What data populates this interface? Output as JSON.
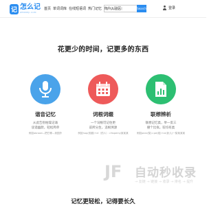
{
  "header": {
    "logo_glyph": "记",
    "logo_text": "怎么记",
    "logo_sub": "ZENMEJI.COM",
    "nav": [
      "首页",
      "单词词库",
      "在线短语词",
      "热门记忆",
      "商户入驻区"
    ],
    "search_placeholder": "查询英语单词",
    "search_button": "Search",
    "login_label": "登录"
  },
  "hero": {
    "title": "花更少的时间，记更多的东西"
  },
  "features": [
    {
      "icon": "microphone-icon",
      "color": "#4aa3ea",
      "title": "谐音记忆",
      "lines": [
        "从此告别枯燥记诵",
        "谈谐幽默，轻松简单"
      ],
      "note": "例如abroad—把它哪—到国外"
    },
    {
      "icon": "calendar-icon",
      "color": "#ee5a5a",
      "title": "词根词缀",
      "lines": [
        "一个词根可记住更",
        "前所分生，追根溯源"
      ],
      "note": "例如hop(双腿)+el（的人）=Hopemy某某某"
    },
    {
      "icon": "document-chart-icon",
      "color": "#2dbf72",
      "title": "联想辨析",
      "lines": [
        "联想记忆类，举一反三",
        "撞个比拟，较均有类"
      ],
      "note": "例如pear(梨)=pe(碰)+ar(卧儿)一梨某某某"
    }
  ],
  "watermark": {
    "logo": "JF",
    "title": "自动秒收录",
    "sub": "→ 友链 → 链接 → 收录 → 排名 → 提升"
  },
  "footer": {
    "slogan": "记忆更轻松，记得要长久"
  }
}
